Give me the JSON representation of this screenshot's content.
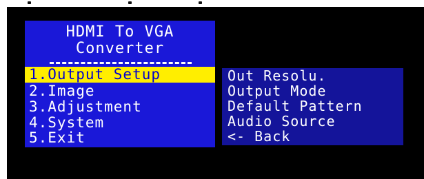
{
  "osd": {
    "title_line1": "HDMI To VGA",
    "title_line2": "Converter",
    "separator": "-------------",
    "main_menu": [
      {
        "label": "1.Output Setup",
        "selected": true
      },
      {
        "label": "2.Image",
        "selected": false
      },
      {
        "label": "3.Adjustment",
        "selected": false
      },
      {
        "label": "4.System",
        "selected": false
      },
      {
        "label": "5.Exit",
        "selected": false
      }
    ],
    "submenu": [
      {
        "label": "Out Resolu."
      },
      {
        "label": "Output Mode"
      },
      {
        "label": "Default Pattern"
      },
      {
        "label": "Audio Source"
      },
      {
        "label": "<- Back"
      }
    ]
  },
  "colors": {
    "main_menu_bg": "#1a18d8",
    "submenu_bg": "#14149a",
    "highlight_bg": "#ffee00",
    "highlight_text": "#0000d0",
    "screen_bg": "#000000"
  }
}
